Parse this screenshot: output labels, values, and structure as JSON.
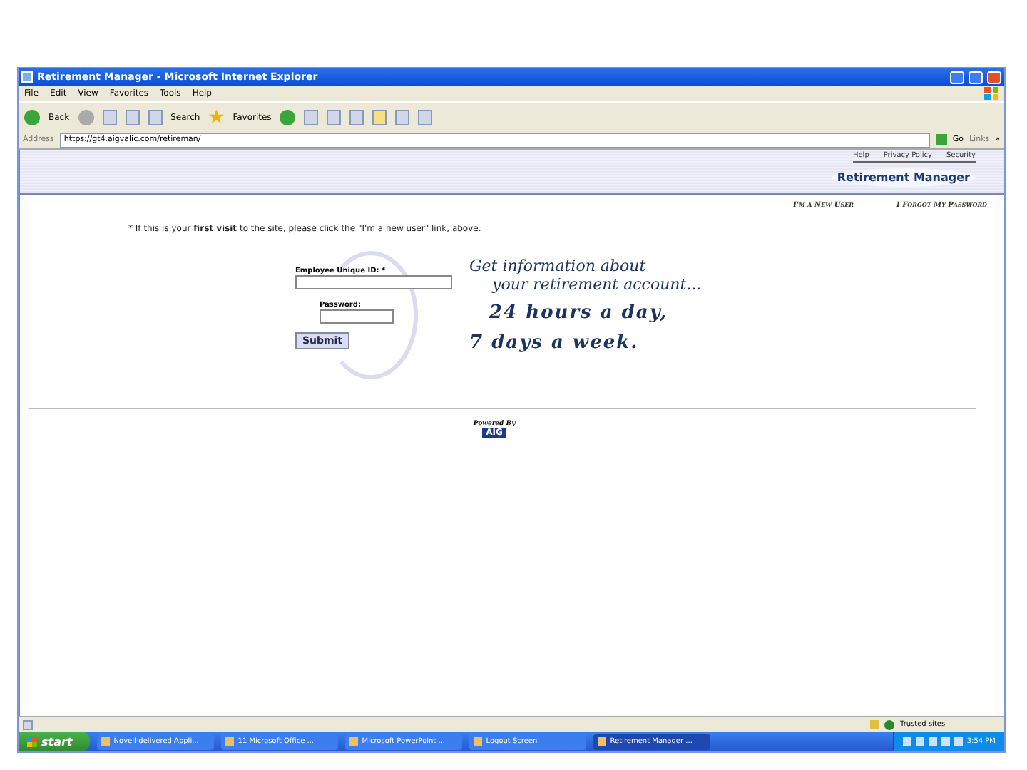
{
  "window": {
    "title": "Retirement Manager - Microsoft Internet Explorer"
  },
  "menu": [
    "File",
    "Edit",
    "View",
    "Favorites",
    "Tools",
    "Help"
  ],
  "toolbar": {
    "back": "Back",
    "search": "Search",
    "favorites": "Favorites"
  },
  "address_bar": {
    "label": "Address",
    "value": "https://gt4.aigvalic.com/retireman/",
    "go": "Go",
    "links": "Links",
    "more": "»"
  },
  "page": {
    "top_links": [
      "Help",
      "Privacy Policy",
      "Security"
    ],
    "brand": "Retirement Manager",
    "user_links": [
      "I'm a New User",
      "I Forgot My Password"
    ],
    "notice": "* If this is your **first visit** to the site, please click the \"I'm a new user\" link, above.",
    "fields": [
      {
        "label": "Employee Unique ID: *"
      },
      {
        "label": "Password:"
      }
    ],
    "submit": "Submit",
    "promo": [
      {
        "kind": "script",
        "text": "Get information about"
      },
      {
        "kind": "script",
        "text": "your retirement account..."
      },
      {
        "kind": "bold",
        "text": "24 hours a day,"
      },
      {
        "kind": "bold",
        "text": "7 days a week."
      }
    ],
    "powered_by": "Powered By",
    "logo": "AIG"
  },
  "status_bar": {
    "zone": "Trusted sites"
  },
  "taskbar": {
    "start": "start",
    "tasks": [
      {
        "label": "Novell-delivered Appli...",
        "selected": false
      },
      {
        "label": "11 Microsoft Office ...",
        "selected": false
      },
      {
        "label": "Microsoft PowerPoint ...",
        "selected": false
      },
      {
        "label": "Logout Screen",
        "selected": false
      },
      {
        "label": "Retirement Manager ...",
        "selected": true
      }
    ],
    "clock": "3:54 PM"
  }
}
